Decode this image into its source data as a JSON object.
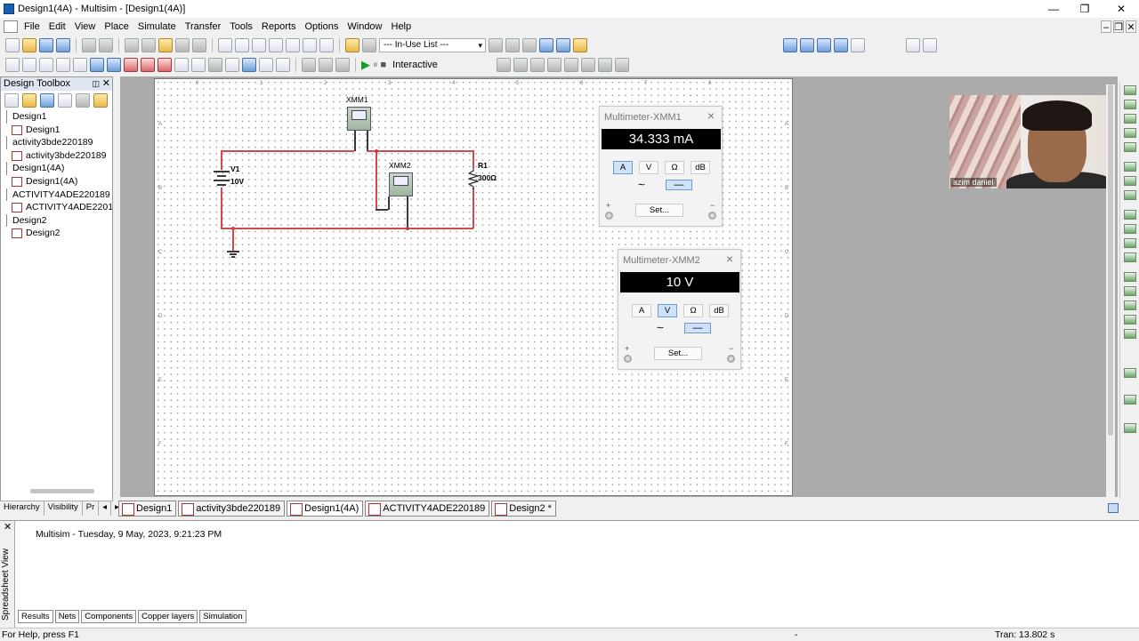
{
  "window": {
    "title": "Design1(4A) - Multisim - [Design1(4A)]",
    "min": "—",
    "max": "❐",
    "close": "✕"
  },
  "menu": [
    "File",
    "Edit",
    "View",
    "Place",
    "Simulate",
    "Transfer",
    "Tools",
    "Reports",
    "Options",
    "Window",
    "Help"
  ],
  "toolbar": {
    "in_use_list": "--- In-Use List ---",
    "interactive": "Interactive",
    "run_icon": "▶",
    "pause_icon": "⏸",
    "stop_icon": "■"
  },
  "toolbox": {
    "title": "Design Toolbox",
    "tree": [
      {
        "label": "Design1",
        "level": 1
      },
      {
        "label": "Design1",
        "level": 2
      },
      {
        "label": "activity3bde220189",
        "level": 1
      },
      {
        "label": "activity3bde220189",
        "level": 2
      },
      {
        "label": "Design1(4A)",
        "level": 1
      },
      {
        "label": "Design1(4A)",
        "level": 2
      },
      {
        "label": "ACTIVITY4ADE220189",
        "level": 1
      },
      {
        "label": "ACTIVITY4ADE220189",
        "level": 2
      },
      {
        "label": "Design2",
        "level": 1
      },
      {
        "label": "Design2",
        "level": 2
      }
    ],
    "tabs": [
      "Hierarchy",
      "Visibility",
      "Pr",
      "◂",
      "▸"
    ]
  },
  "schematic": {
    "xmm1": "XMM1",
    "xmm2": "XMM2",
    "v1_name": "V1",
    "v1_value": "10V",
    "r1_name": "R1",
    "r1_value": "300Ω"
  },
  "multimeter1": {
    "title": "Multimeter-XMM1",
    "display": "34.333 mA",
    "modes": [
      "A",
      "V",
      "Ω",
      "dB"
    ],
    "active_mode": "A",
    "set": "Set...",
    "plus": "+",
    "minus": "−"
  },
  "multimeter2": {
    "title": "Multimeter-XMM2",
    "display": "10 V",
    "modes": [
      "A",
      "V",
      "Ω",
      "dB"
    ],
    "active_mode": "V",
    "set": "Set...",
    "plus": "+",
    "minus": "−"
  },
  "webcam": {
    "name": "azim daniel"
  },
  "doc_tabs": [
    "Design1",
    "activity3bde220189",
    "Design1(4A)",
    "ACTIVITY4ADE220189",
    "Design2 *"
  ],
  "spreadsheet": {
    "side_label": "Spreadsheet View",
    "log": "Multisim  -  Tuesday, 9 May, 2023, 9:21:23 PM",
    "tabs": [
      "Results",
      "Nets",
      "Components",
      "Copper layers",
      "Simulation"
    ]
  },
  "status": {
    "help": "For Help, press F1",
    "mid": "-",
    "tran": "Tran: 13.802 s"
  },
  "colors": {
    "wire": "#d34a4a",
    "display_bg": "#000000",
    "active_mode": "#cfe2f7"
  }
}
